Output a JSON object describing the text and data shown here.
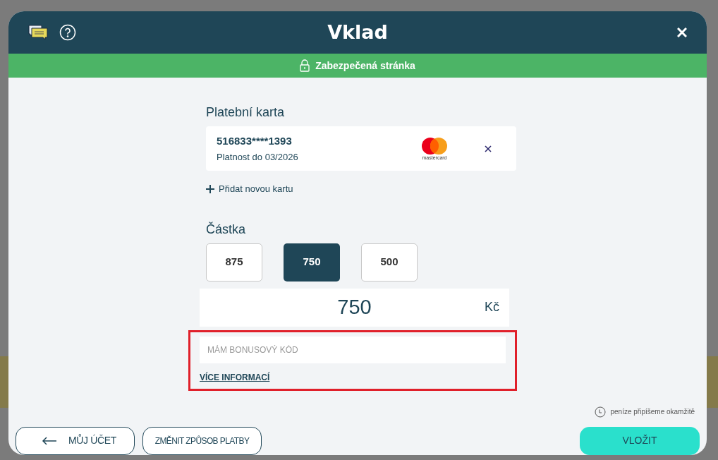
{
  "header": {
    "title": "Vklad"
  },
  "secure_banner": {
    "text": "Zabezpečená stránka"
  },
  "payment_card": {
    "heading": "Platební karta",
    "number": "516833****1393",
    "expiry": "Platnost do 03/2026",
    "brand": "mastercard",
    "add_card": "Přidat novou kartu"
  },
  "amount": {
    "heading": "Částka",
    "presets": [
      {
        "label": "875",
        "selected": false
      },
      {
        "label": "750",
        "selected": true
      },
      {
        "label": "500",
        "selected": false
      }
    ],
    "value": "750",
    "currency": "Kč"
  },
  "bonus": {
    "placeholder": "MÁM BONUSOVÝ KÓD",
    "link": "VÍCE INFORMACÍ",
    "highlighted": true
  },
  "note": "peníze připíšeme okamžitě",
  "footer_buttons": [
    {
      "kind": "back",
      "label": "MŮJ ÚČET"
    },
    {
      "kind": "outline",
      "label": "ZMĚNIT ZPŮSOB PLATBY"
    },
    {
      "kind": "primary",
      "label": "VLOŽIT"
    }
  ]
}
